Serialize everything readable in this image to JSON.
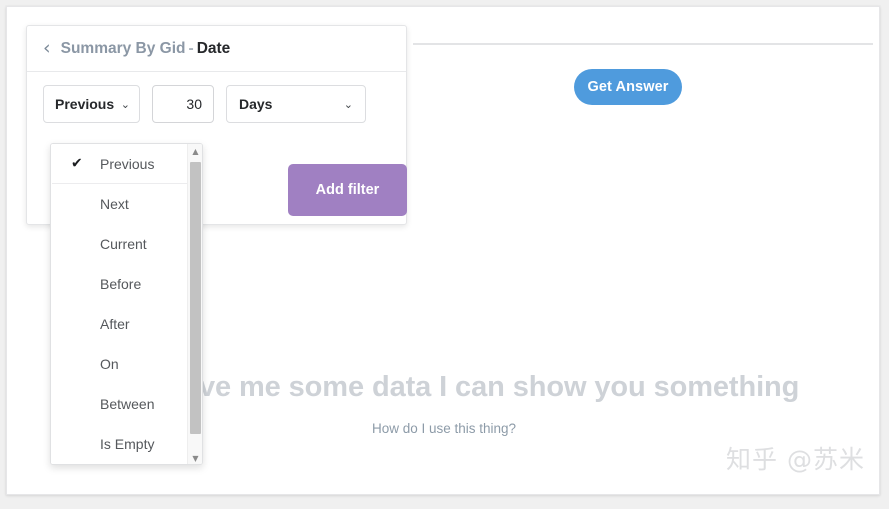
{
  "answer_pane": {
    "get_answer_label": "Get Answer",
    "empty_state_headline": "If you give me some data I can show you something",
    "empty_state_link": "How do I use this thing?"
  },
  "filter_popover": {
    "back_icon": "‹",
    "breadcrumb": {
      "source": "Summary By Gid",
      "separator": "-",
      "field": "Date"
    },
    "operator_select": {
      "value": "Previous",
      "caret": "⌄"
    },
    "amount_input": {
      "value": "30",
      "placeholder": "30"
    },
    "unit_select": {
      "value": "Days",
      "caret": "⌄"
    },
    "add_filter_label": "Add filter",
    "operator_dropdown": {
      "check_icon": "✔",
      "selected": "Previous",
      "options": [
        "Previous",
        "Next",
        "Current",
        "Before",
        "After",
        "On",
        "Between",
        "Is Empty"
      ],
      "scrollbar": {
        "up_arrow": "▲",
        "down_arrow": "▼"
      }
    }
  },
  "watermark": "知乎 @苏米",
  "colors": {
    "accent_blue": "#4f9bdd",
    "accent_purple": "#a080c2",
    "empty_state_text": "#ced2d7",
    "link": "#8d9ba8"
  }
}
